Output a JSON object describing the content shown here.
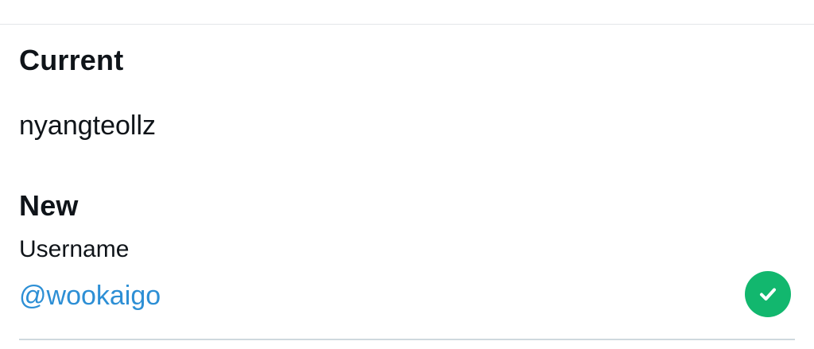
{
  "current": {
    "heading": "Current",
    "username": "nyangteollz"
  },
  "new": {
    "heading": "New",
    "field_label": "Username",
    "value": "@wookaigo",
    "status_icon": "check-circle-icon"
  },
  "colors": {
    "text": "#0f1419",
    "accent": "#2d8fd5",
    "success": "#12b76e",
    "divider": "#cfd9de"
  }
}
